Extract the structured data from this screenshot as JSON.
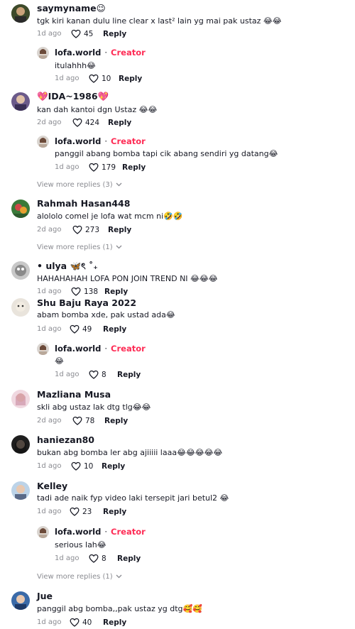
{
  "labels": {
    "reply": "Reply",
    "creator": "Creator",
    "sep": "·"
  },
  "comments": [
    {
      "name": "saymyname😉",
      "text": "tgk kiri kanan dulu line clear x last² lain yg mai pak ustaz 😂😂",
      "time": "1d ago",
      "likes": "45"
    },
    {
      "name": "lofa.world",
      "text": "itulahhh😂",
      "time": "1d ago",
      "likes": "10"
    },
    {
      "name": "💖IDA~1986💖",
      "text": "kan dah kantoi dgn Ustaz 😂😂",
      "time": "2d ago",
      "likes": "424"
    },
    {
      "name": "lofa.world",
      "text": "panggil abang bomba tapi cik abang sendiri yg datang😂",
      "time": "1d ago",
      "likes": "179"
    },
    {
      "name": "Rahmah Hasan448",
      "text": "alololo comel je lofa wat mcm ni🤣🤣",
      "time": "2d ago",
      "likes": "273"
    },
    {
      "name": "• ulya 🦋ৎ ˚₊",
      "text": "HAHAHAHAH LOFA PON JOIN TREND NI 😂😂😂",
      "time": "1d ago",
      "likes": "138"
    },
    {
      "name": "Shu Baju Raya 2022",
      "text": "abam bomba xde, pak ustad ada😂",
      "time": "1d ago",
      "likes": "49"
    },
    {
      "name": "lofa.world",
      "text": "😂",
      "time": "1d ago",
      "likes": "8"
    },
    {
      "name": "Mazliana Musa",
      "text": "skli abg ustaz lak dtg tlg😂😂",
      "time": "2d ago",
      "likes": "78"
    },
    {
      "name": "haniezan80",
      "text": "bukan abg bomba ler abg ajiiiii laaa😂😂😂😂😂",
      "time": "1d ago",
      "likes": "10"
    },
    {
      "name": "Kelley",
      "text": "tadi ade naik fyp video laki tersepit jari betul2 😂",
      "time": "1d ago",
      "likes": "23"
    },
    {
      "name": "lofa.world",
      "text": "serious lah😂",
      "time": "1d ago",
      "likes": "8"
    },
    {
      "name": "Jue",
      "text": "panggil abg bomba,,pak ustaz yg dtg🥰🥰",
      "time": "1d ago",
      "likes": "40"
    }
  ],
  "view_more": [
    {
      "label": "View more replies (3)"
    },
    {
      "label": "View more replies (1)"
    },
    {
      "label": "View more replies (1)"
    }
  ],
  "colors": {
    "creator": "#fe2c55",
    "muted": "#8a8b91",
    "text": "#161823"
  },
  "icons": {
    "like": "heart-icon",
    "expand": "chevron-down-icon"
  }
}
